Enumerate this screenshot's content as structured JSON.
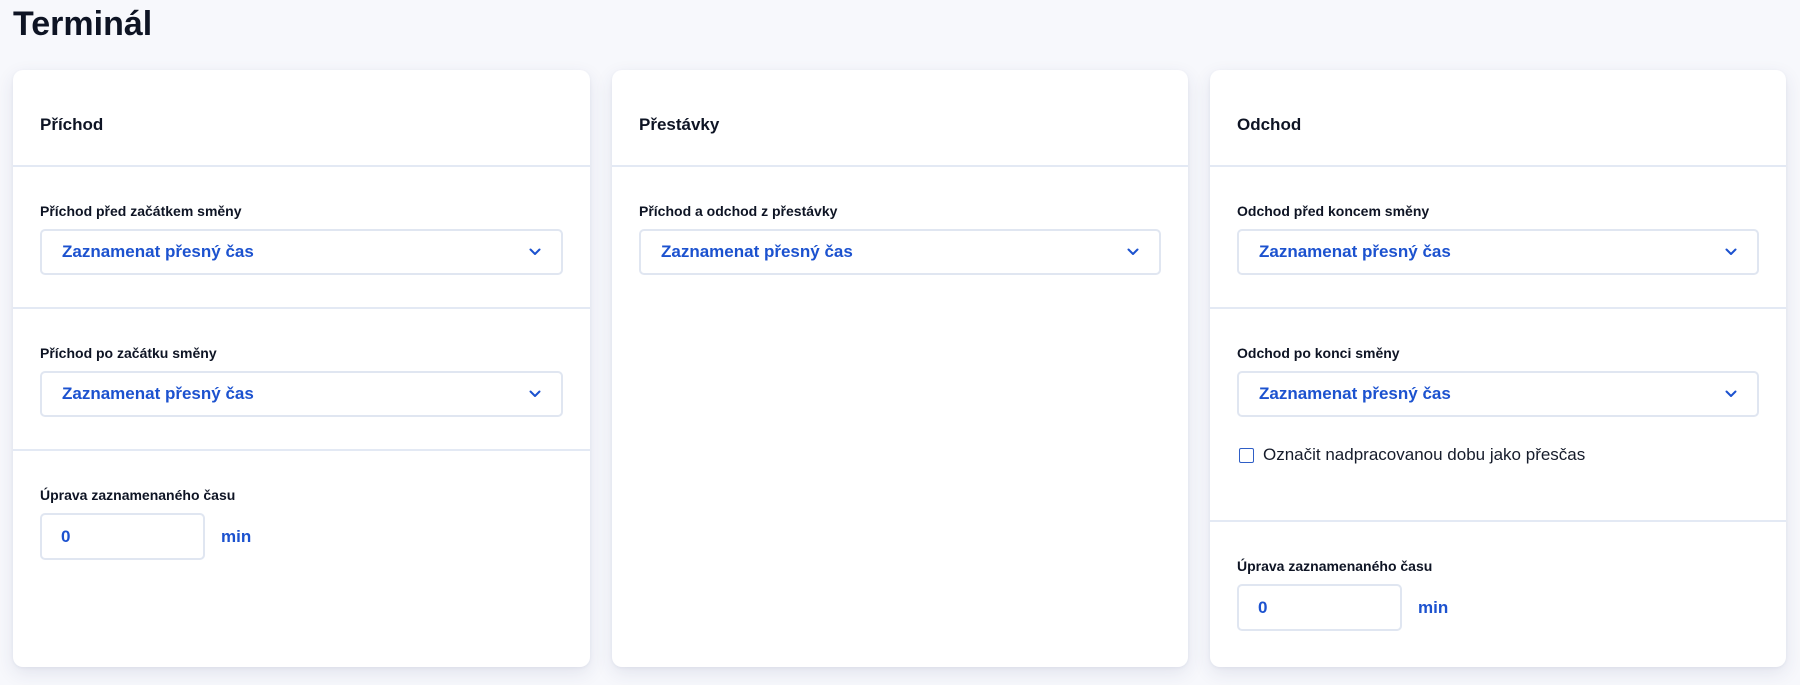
{
  "page": {
    "title": "Terminál"
  },
  "cards": [
    {
      "title": "Příchod",
      "sections": [
        {
          "label": "Příchod před začátkem směny",
          "value": "Zaznamenat přesný čas"
        },
        {
          "label": "Příchod po začátku směny",
          "value": "Zaznamenat přesný čas"
        },
        {
          "label": "Úprava zaznamenaného času",
          "number": "0",
          "unit": "min"
        }
      ]
    },
    {
      "title": "Přestávky",
      "sections": [
        {
          "label": "Příchod a odchod z přestávky",
          "value": "Zaznamenat přesný čas"
        }
      ]
    },
    {
      "title": "Odchod",
      "sections": [
        {
          "label": "Odchod před koncem směny",
          "value": "Zaznamenat přesný čas"
        },
        {
          "label": "Odchod po konci směny",
          "value": "Zaznamenat přesný čas",
          "checkbox": {
            "label": "Označit nadpracovanou dobu jako přesčas",
            "checked": false
          }
        },
        {
          "label": "Úprava zaznamenaného času",
          "number": "0",
          "unit": "min"
        }
      ]
    }
  ],
  "colors": {
    "accent": "#1c52cf",
    "border": "#e0e6f1",
    "background": "#f7f8fc"
  },
  "icons": {
    "select_indicator": "chevron-down-icon"
  }
}
